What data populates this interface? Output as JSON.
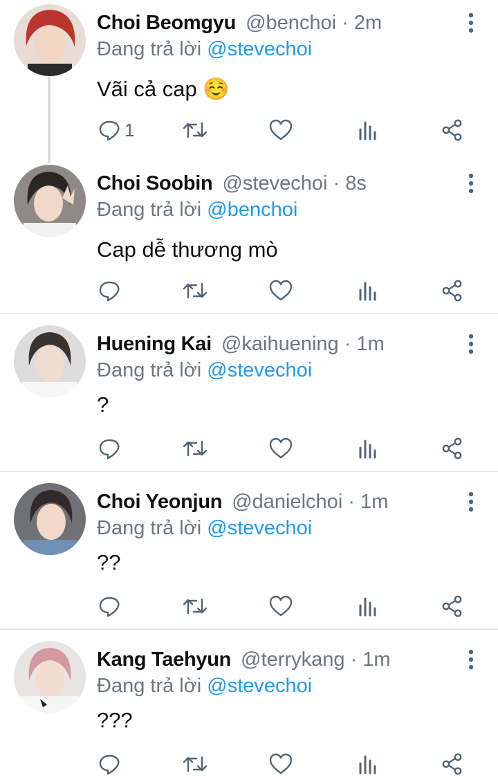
{
  "tweets": [
    {
      "name": "Choi Beomgyu",
      "handle": "@benchoi",
      "time": "2m",
      "reply_prefix": "Đang trả lời",
      "reply_to": "@stevechoi",
      "text": "Vãi cả cap ☺️",
      "reply_count": "1",
      "avatar_hair": "#b9362f"
    },
    {
      "name": "Choi Soobin",
      "handle": "@stevechoi",
      "time": "8s",
      "reply_prefix": "Đang trả lời",
      "reply_to": "@benchoi",
      "text": "Cap dễ thương mò",
      "reply_count": "",
      "avatar_hair": "#2a2626"
    },
    {
      "name": "Huening Kai",
      "handle": "@kaihuening",
      "time": "1m",
      "reply_prefix": "Đang trả lời",
      "reply_to": "@stevechoi",
      "text": "?",
      "reply_count": "",
      "avatar_hair": "#3a3330"
    },
    {
      "name": "Choi Yeonjun",
      "handle": "@danielchoi",
      "time": "1m",
      "reply_prefix": "Đang trả lời",
      "reply_to": "@stevechoi",
      "text": "??",
      "reply_count": "",
      "avatar_hair": "#33292a"
    },
    {
      "name": "Kang Taehyun",
      "handle": "@terrykang",
      "time": "1m",
      "reply_prefix": "Đang trả lời",
      "reply_to": "@stevechoi",
      "text": "???",
      "reply_count": "",
      "avatar_hair": "#d49aa0"
    }
  ],
  "separator": "·",
  "icons": {
    "reply": "reply-icon",
    "retweet": "retweet-icon",
    "like": "like-icon",
    "analytics": "analytics-icon",
    "share": "share-icon",
    "more": "more-options-icon"
  },
  "colors": {
    "mention": "#1d9bf0",
    "muted": "#6e767d",
    "divider": "#e6e9eb",
    "thread_line": "#d6dbdf"
  }
}
